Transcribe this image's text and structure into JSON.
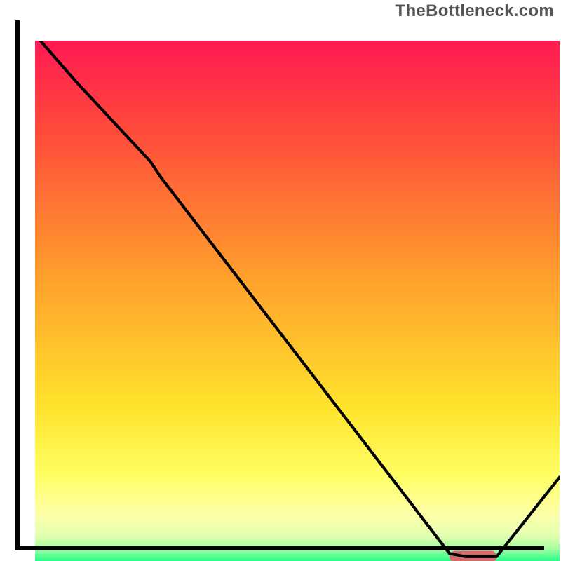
{
  "watermark": "TheBottleneck.com",
  "chart_data": {
    "type": "line",
    "title": "",
    "xlabel": "",
    "ylabel": "",
    "xlim": [
      0,
      100
    ],
    "ylim": [
      0,
      100
    ],
    "gradient_stops": [
      {
        "offset": 0.0,
        "color": "#ff1a52"
      },
      {
        "offset": 0.17,
        "color": "#ff4a3b"
      },
      {
        "offset": 0.45,
        "color": "#ffa02c"
      },
      {
        "offset": 0.7,
        "color": "#ffe42c"
      },
      {
        "offset": 0.83,
        "color": "#ffff66"
      },
      {
        "offset": 0.9,
        "color": "#fdffa8"
      },
      {
        "offset": 0.94,
        "color": "#e4ffb2"
      },
      {
        "offset": 0.965,
        "color": "#a7ff9e"
      },
      {
        "offset": 0.985,
        "color": "#40ff8e"
      },
      {
        "offset": 1.0,
        "color": "#00e38a"
      }
    ],
    "curve": {
      "name": "bottleneck-curve",
      "x": [
        1,
        8,
        22,
        24,
        79,
        82,
        88,
        100
      ],
      "y": [
        100,
        92,
        77,
        74,
        2.5,
        1.9,
        1.9,
        17
      ]
    },
    "marker": {
      "name": "optimal-region",
      "shape": "rounded-bar",
      "color": "#d46a6a",
      "x_start": 79,
      "x_end": 88,
      "y": 1.9,
      "height": 2.2
    }
  }
}
